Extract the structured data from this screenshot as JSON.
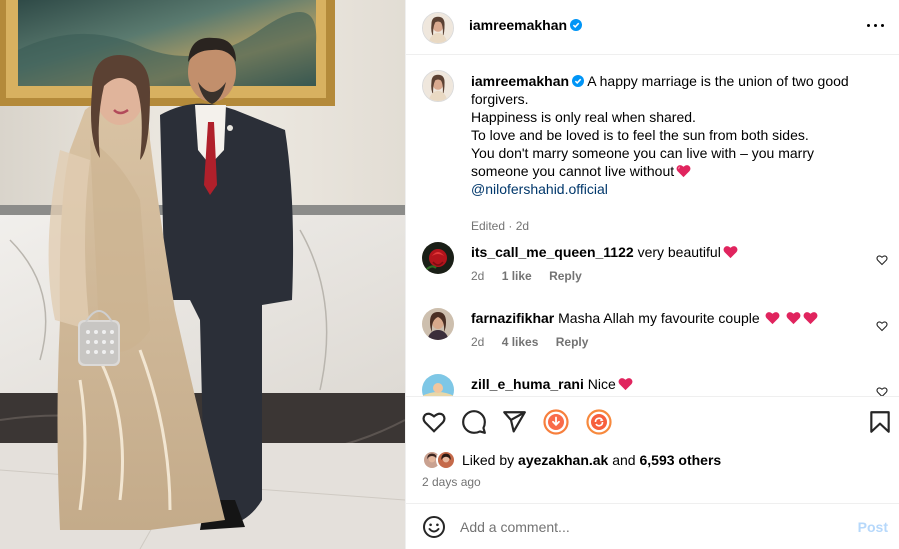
{
  "post": {
    "username": "iamreemakhan",
    "caption_lines": [
      "A happy marriage is the union of two good",
      "forgivers.",
      "Happiness is only real when shared.",
      "To love and be loved is to feel the sun from both sides.",
      "You don't marry someone you can live with – you marry",
      "someone you cannot live without"
    ],
    "mention": "@nilofershahid.official",
    "edited": "Edited · 2d"
  },
  "comments": [
    {
      "username": "its_call_me_queen_1122",
      "text": "very beautiful",
      "time": "2d",
      "likes": "1 like",
      "reply": "Reply"
    },
    {
      "username": "farnazifikhar",
      "text": "Masha Allah my favourite couple",
      "time": "2d",
      "likes": "4 likes",
      "reply": "Reply"
    },
    {
      "username": "zill_e_huma_rani",
      "text": "Nice"
    }
  ],
  "likes": {
    "prefix": "Liked by",
    "user": "ayezakhan.ak",
    "joiner": "and",
    "others": "6,593 others"
  },
  "posted_ago": "2 days ago",
  "comment_box": {
    "placeholder": "Add a comment...",
    "post_label": "Post"
  },
  "icons": {
    "verified": "verified-badge-icon",
    "more": "more-options-icon",
    "like": "heart-outline-icon",
    "comment": "comment-bubble-icon",
    "share": "paper-plane-icon",
    "ext1": "download-circle-icon",
    "ext2": "refresh-circle-icon",
    "save": "bookmark-icon",
    "emoji": "emoji-icon"
  },
  "colors": {
    "verified": "#0095f6",
    "mention": "#00376b",
    "post_disabled": "#b6d8fb",
    "heart": "#e0245e",
    "ext1": "#f77f3d",
    "ext2": "#f75a3d"
  }
}
